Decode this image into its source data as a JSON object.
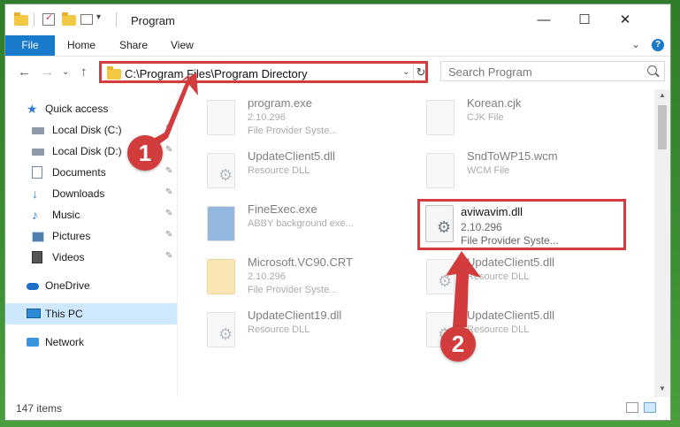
{
  "window": {
    "title": "Program",
    "controls": {
      "minimize": "—",
      "maximize": "☐",
      "close": "✕"
    }
  },
  "ribbon": {
    "tabs": [
      "File",
      "Home",
      "Share",
      "View"
    ],
    "expand": "⌄",
    "help": "?"
  },
  "nav": {
    "back": "←",
    "forward": "→",
    "recent": "⌄",
    "up": "↑",
    "address": "C:\\Program Files\\Program Directory",
    "address_dropdown": "⌄",
    "refresh": "↻",
    "search_placeholder": "Search Program"
  },
  "sidebar": {
    "items": [
      {
        "label": "Quick access",
        "icon": "star-icon"
      },
      {
        "label": "Local Disk (C:)",
        "icon": "disk-icon",
        "pinned": true
      },
      {
        "label": "Local Disk (D:)",
        "icon": "disk-icon",
        "pinned": true
      },
      {
        "label": "Documents",
        "icon": "documents-icon",
        "pinned": true
      },
      {
        "label": "Downloads",
        "icon": "download-icon",
        "pinned": true
      },
      {
        "label": "Music",
        "icon": "music-icon",
        "pinned": true
      },
      {
        "label": "Pictures",
        "icon": "pictures-icon",
        "pinned": true
      },
      {
        "label": "Videos",
        "icon": "videos-icon",
        "pinned": true
      },
      {
        "label": "OneDrive",
        "icon": "onedrive-icon"
      },
      {
        "label": "This PC",
        "icon": "pc-icon",
        "selected": true
      },
      {
        "label": "Network",
        "icon": "network-icon"
      }
    ],
    "pin_glyph": "📌"
  },
  "files": [
    {
      "name": "program.exe",
      "line2": "2.10.296",
      "line3": "File Provider Syste..."
    },
    {
      "name": "Korean.cjk",
      "line2": "CJK File",
      "line3": ""
    },
    {
      "name": "UpdateClient5.dll",
      "line2": "Resource DLL",
      "line3": ""
    },
    {
      "name": "SndToWP15.wcm",
      "line2": "WCM File",
      "line3": ""
    },
    {
      "name": "FineExec.exe",
      "line2": "ABBY background exe...",
      "line3": ""
    },
    {
      "name": "Microsoft.VC90.CRT",
      "line2": "2.10.296",
      "line3": "File Provider Syste..."
    },
    {
      "name": "UpdateClient5.dll",
      "line2": "Resource DLL",
      "line3": ""
    },
    {
      "name": "UpdateClient19.dll",
      "line2": "Resource DLL",
      "line3": ""
    },
    {
      "name": "UpdateClient5.dll",
      "line2": "Resource DLL",
      "line3": ""
    }
  ],
  "highlighted_file": {
    "name": "aviwavim.dll",
    "line2": "2.10.296",
    "line3": "File Provider Syste..."
  },
  "status": {
    "count": "147 items"
  },
  "annotations": {
    "badge1": "1",
    "badge2": "2"
  },
  "colors": {
    "accent": "#1979ca",
    "annotation": "#d23c3c",
    "selected": "#cde8ff"
  }
}
